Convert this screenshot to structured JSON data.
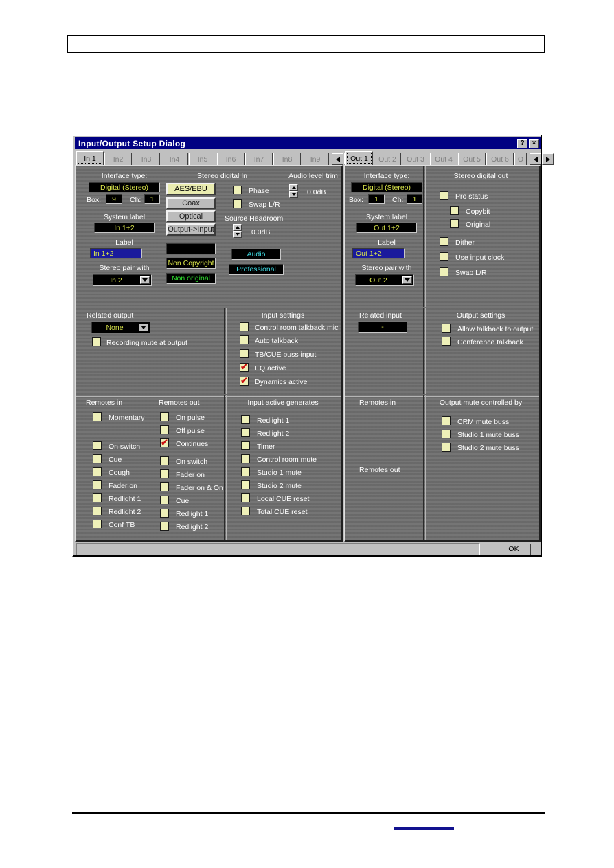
{
  "dialog": {
    "title": "Input/Output Setup Dialog",
    "help_button": "?",
    "close_button": "×",
    "ok_button": "OK"
  },
  "input_tabs": {
    "items": [
      "In 1",
      "In2",
      "In3",
      "In4",
      "In5",
      "In6",
      "In7",
      "In8",
      "In9"
    ],
    "active": "In 1",
    "prev_arrow": "◄",
    "next_arrow": "►"
  },
  "output_tabs": {
    "items": [
      "Out 1",
      "Out 2",
      "Out 3",
      "Out 4",
      "Out 5",
      "Out 6",
      "O"
    ],
    "active": "Out 1",
    "prev_arrow": "◄",
    "next_arrow": "►"
  },
  "input_panel": {
    "interface": {
      "title": "Interface type:",
      "type_value": "Digital (Stereo)",
      "box_label": "Box:",
      "box_value": "9",
      "ch_label": "Ch:",
      "ch_value": "1",
      "system_label_title": "System label",
      "system_label_value": "In 1+2",
      "label_title": "Label",
      "label_value": "In 1+2",
      "stereo_pair_title": "Stereo pair with",
      "stereo_pair_value": "In 2"
    },
    "stereo_digital_in": {
      "title": "Stereo digital In",
      "buttons": [
        {
          "label": "AES/EBU",
          "selected": true
        },
        {
          "label": "Coax",
          "selected": false
        },
        {
          "label": "Optical",
          "selected": false
        },
        {
          "label": "Output->Input",
          "selected": false
        }
      ],
      "status_blank": "",
      "copyright_status": "Non Copyright",
      "original_status": "Non original",
      "phase_label": "Phase",
      "phase_checked": false,
      "swap_lr_label": "Swap L/R",
      "swap_lr_checked": false,
      "source_headroom_title": "Source Headroom",
      "source_headroom_value": "0.0dB",
      "audio_mode": "Audio",
      "pro_mode": "Professional"
    },
    "audio_level_trim": {
      "title": "Audio level trim",
      "value": "0.0dB"
    },
    "related_output": {
      "title": "Related output",
      "value": "None",
      "recording_mute_label": "Recording mute at output",
      "recording_mute_checked": false
    },
    "input_settings": {
      "title": "Input settings",
      "items": [
        {
          "label": "Control room talkback mic",
          "checked": false
        },
        {
          "label": "Auto talkback",
          "checked": false
        },
        {
          "label": "TB/CUE buss input",
          "checked": false
        },
        {
          "label": "EQ active",
          "checked": true
        },
        {
          "label": "Dynamics active",
          "checked": true
        }
      ]
    },
    "remotes_in": {
      "title": "Remotes in",
      "group1": [
        {
          "label": "Momentary",
          "checked": false
        }
      ],
      "group2": [
        {
          "label": "On switch",
          "checked": false
        },
        {
          "label": "Cue",
          "checked": false
        },
        {
          "label": "Cough",
          "checked": false
        },
        {
          "label": "Fader on",
          "checked": false
        },
        {
          "label": "Redlight 1",
          "checked": false
        },
        {
          "label": "Redlight 2",
          "checked": false
        },
        {
          "label": "Conf TB",
          "checked": false
        }
      ]
    },
    "remotes_out": {
      "title": "Remotes out",
      "group1": [
        {
          "label": "On pulse",
          "checked": false
        },
        {
          "label": "Off pulse",
          "checked": false
        },
        {
          "label": "Continues",
          "checked": true
        }
      ],
      "group2": [
        {
          "label": "On  switch",
          "checked": false
        },
        {
          "label": "Fader on",
          "checked": false
        },
        {
          "label": "Fader on & On",
          "checked": false
        },
        {
          "label": "Cue",
          "checked": false
        },
        {
          "label": "Redlight 1",
          "checked": false
        },
        {
          "label": "Redlight 2",
          "checked": false
        }
      ]
    },
    "input_active_generates": {
      "title": "Input active generates",
      "items": [
        {
          "label": "Redlight 1",
          "checked": false
        },
        {
          "label": "Redlight 2",
          "checked": false
        },
        {
          "label": "Timer",
          "checked": false
        },
        {
          "label": "Control room mute",
          "checked": false
        },
        {
          "label": "Studio 1 mute",
          "checked": false
        },
        {
          "label": "Studio 2 mute",
          "checked": false
        },
        {
          "label": "Local CUE reset",
          "checked": false
        },
        {
          "label": "Total CUE reset",
          "checked": false
        }
      ]
    }
  },
  "output_panel": {
    "interface": {
      "title": "Interface type:",
      "type_value": "Digital (Stereo)",
      "box_label": "Box:",
      "box_value": "1",
      "ch_label": "Ch:",
      "ch_value": "1",
      "system_label_title": "System label",
      "system_label_value": "Out 1+2",
      "label_title": "Label",
      "label_value": "Out 1+2",
      "stereo_pair_title": "Stereo pair with",
      "stereo_pair_value": "Out 2"
    },
    "stereo_digital_out": {
      "title": "Stereo digital out",
      "items": [
        {
          "label": "Pro status",
          "checked": false,
          "indent": 0
        },
        {
          "label": "Copybit",
          "checked": false,
          "indent": 1
        },
        {
          "label": "Original",
          "checked": false,
          "indent": 1
        },
        {
          "label": "Dither",
          "checked": false,
          "indent": 0
        },
        {
          "label": "Use input clock",
          "checked": false,
          "indent": 0
        },
        {
          "label": "Swap L/R",
          "checked": false,
          "indent": 0
        }
      ]
    },
    "related_input": {
      "title": "Related input",
      "value": "-"
    },
    "output_settings": {
      "title": "Output settings",
      "items": [
        {
          "label": "Allow talkback to output",
          "checked": false
        },
        {
          "label": "Conference talkback",
          "checked": false
        }
      ]
    },
    "remotes_in": {
      "title": "Remotes in"
    },
    "remotes_out": {
      "title": "Remotes out"
    },
    "output_mute_controlled_by": {
      "title": "Output mute controlled by",
      "items": [
        {
          "label": "CRM mute buss",
          "checked": false
        },
        {
          "label": "Studio 1 mute buss",
          "checked": false
        },
        {
          "label": "Studio 2 mute buss",
          "checked": false
        }
      ]
    }
  },
  "colors": {
    "titlebar": "#000082",
    "window_face": "#c0c0c0",
    "panel_metal": "#6f6f6f",
    "led_text": "#d8e34a",
    "led_bg": "#000000",
    "label_field": "#1a1a9c",
    "check_face": "#eef0b8",
    "check_mark": "#cc1111",
    "cyan_text": "#3fd8e0",
    "green_text": "#2fe02f"
  }
}
